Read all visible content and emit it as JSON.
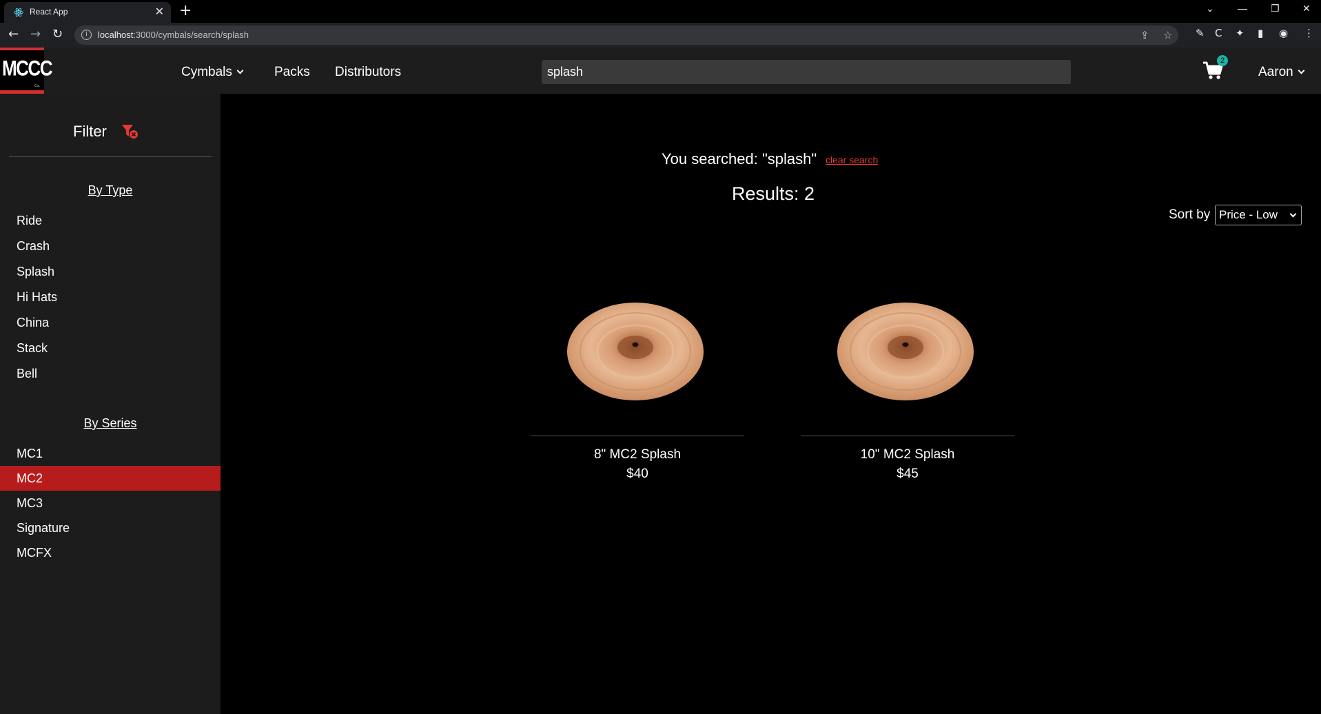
{
  "browser": {
    "tab_title": "React App",
    "tab_close": "✕",
    "new_tab": "+",
    "url_host": "localhost",
    "url_path": ":3000/cymbals/search/splash",
    "win_controls": [
      "⌄",
      "—",
      "❐",
      "✕"
    ]
  },
  "header": {
    "logo_text": "MCCC",
    "logo_sub": "Co.",
    "nav": [
      {
        "label": "Cymbals",
        "has_dropdown": true
      },
      {
        "label": "Packs"
      },
      {
        "label": "Distributors"
      }
    ],
    "search_value": "splash",
    "cart_count": "2",
    "user_name": "Aaron"
  },
  "sidebar": {
    "title": "Filter",
    "by_type_heading": "By Type",
    "types": [
      "Ride",
      "Crash",
      "Splash",
      "Hi Hats",
      "China",
      "Stack",
      "Bell"
    ],
    "by_series_heading": "By Series",
    "series": [
      "MC1",
      "MC2",
      "MC3",
      "Signature",
      "MCFX"
    ],
    "active_series": "MC2"
  },
  "main": {
    "searched_text": "You searched: \"splash\"",
    "clear_search": "clear search",
    "results_text": "Results: 2",
    "sort_label": "Sort by",
    "sort_value": "Price - Low",
    "products": [
      {
        "name": "8\" MC2 Splash",
        "price": "$40"
      },
      {
        "name": "10\" MC2 Splash",
        "price": "$45"
      }
    ]
  },
  "colors": {
    "accent": "#d32f2f",
    "active_bg": "#b71c1c",
    "badge": "#19b5a5",
    "sidebar_bg": "#1c1c1c",
    "header_bg": "#1d1d1d"
  }
}
